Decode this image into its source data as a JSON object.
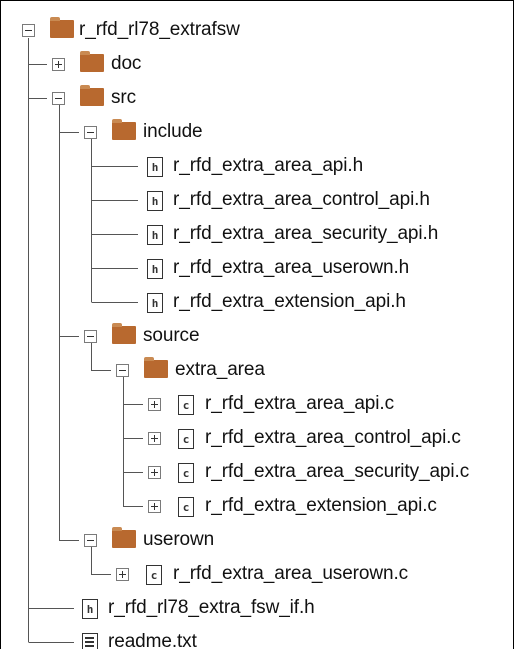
{
  "colors": {
    "folder": "#b8692f",
    "folder_tab": "#c98a52",
    "lines": "#555555",
    "toggle_border": "#7a7a7a"
  },
  "tree": [
    {
      "label": "r_rfd_rl78_extrafsw",
      "kind": "folder",
      "toggle": "minus",
      "icon": "folder-icon"
    },
    {
      "label": "doc",
      "kind": "folder",
      "toggle": "plus",
      "icon": "folder-icon"
    },
    {
      "label": "src",
      "kind": "folder",
      "toggle": "minus",
      "icon": "folder-icon"
    },
    {
      "label": "include",
      "kind": "folder",
      "toggle": "minus",
      "icon": "folder-icon"
    },
    {
      "label": "r_rfd_extra_area_api.h",
      "kind": "file",
      "badge": "h",
      "icon": "header-file-icon"
    },
    {
      "label": "r_rfd_extra_area_control_api.h",
      "kind": "file",
      "badge": "h",
      "icon": "header-file-icon"
    },
    {
      "label": "r_rfd_extra_area_security_api.h",
      "kind": "file",
      "badge": "h",
      "icon": "header-file-icon"
    },
    {
      "label": "r_rfd_extra_area_userown.h",
      "kind": "file",
      "badge": "h",
      "icon": "header-file-icon"
    },
    {
      "label": "r_rfd_extra_extension_api.h",
      "kind": "file",
      "badge": "h",
      "icon": "header-file-icon"
    },
    {
      "label": "source",
      "kind": "folder",
      "toggle": "minus",
      "icon": "folder-icon"
    },
    {
      "label": "extra_area",
      "kind": "folder",
      "toggle": "minus",
      "icon": "folder-icon"
    },
    {
      "label": "r_rfd_extra_area_api.c",
      "kind": "file",
      "badge": "c",
      "toggle": "plus",
      "icon": "c-file-icon"
    },
    {
      "label": "r_rfd_extra_area_control_api.c",
      "kind": "file",
      "badge": "c",
      "toggle": "plus",
      "icon": "c-file-icon"
    },
    {
      "label": "r_rfd_extra_area_security_api.c",
      "kind": "file",
      "badge": "c",
      "toggle": "plus",
      "icon": "c-file-icon"
    },
    {
      "label": "r_rfd_extra_extension_api.c",
      "kind": "file",
      "badge": "c",
      "toggle": "plus",
      "icon": "c-file-icon"
    },
    {
      "label": "userown",
      "kind": "folder",
      "toggle": "minus",
      "icon": "folder-icon"
    },
    {
      "label": "r_rfd_extra_area_userown.c",
      "kind": "file",
      "badge": "c",
      "toggle": "plus",
      "icon": "c-file-icon"
    },
    {
      "label": "r_rfd_rl78_extra_fsw_if.h",
      "kind": "file",
      "badge": "h",
      "icon": "header-file-icon"
    },
    {
      "label": "readme.txt",
      "kind": "text",
      "icon": "text-file-icon"
    }
  ]
}
